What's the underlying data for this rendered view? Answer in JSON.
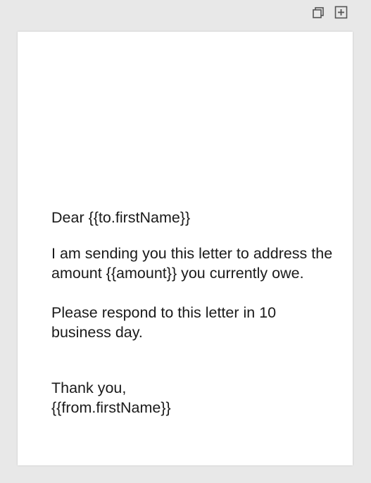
{
  "toolbar": {
    "buttons": [
      {
        "icon": "restore-window-icon"
      },
      {
        "icon": "add-box-icon"
      }
    ]
  },
  "letter": {
    "greeting": "Dear {{to.firstName}}",
    "paragraph1": "I am sending you this letter to address the amount {{amount}} you currently owe.",
    "paragraph2": "Please respond to this letter in 10 business day.",
    "closing": "Thank you,",
    "signature": "{{from.firstName}}"
  },
  "colors": {
    "background": "#e8e8e8",
    "page": "#ffffff",
    "text": "#1a1a1a",
    "icon": "#555555"
  }
}
